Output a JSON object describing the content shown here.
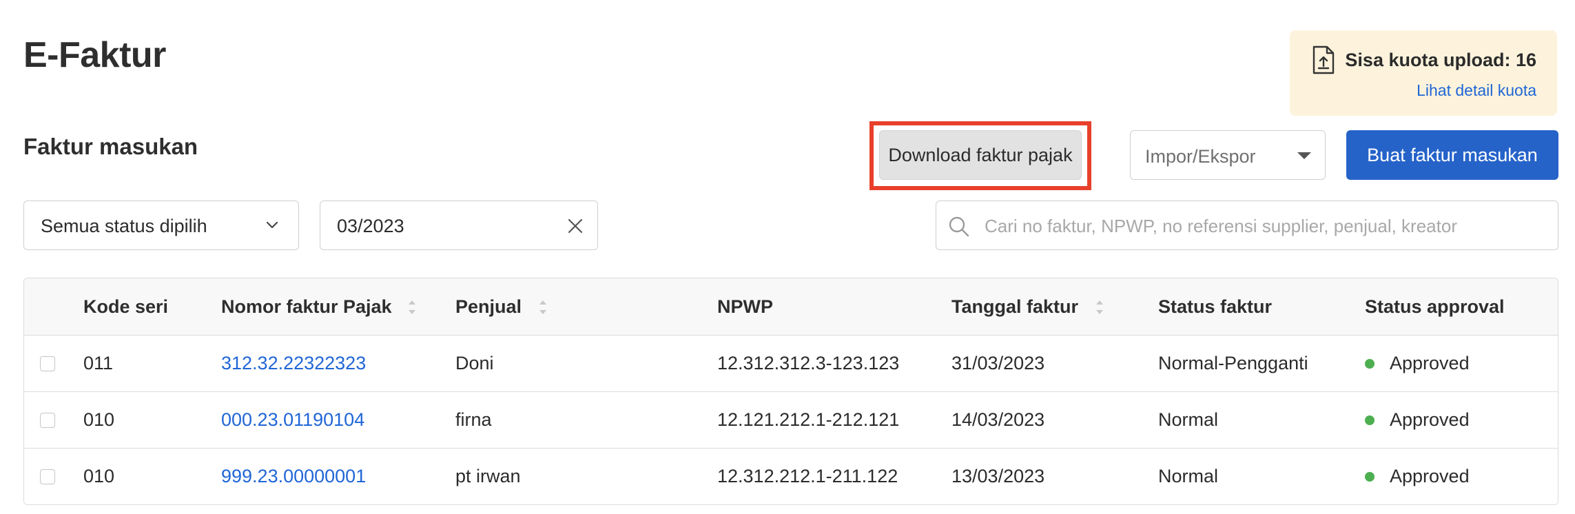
{
  "page": {
    "title": "E-Faktur"
  },
  "quota": {
    "text": "Sisa kuota upload: 16",
    "link": "Lihat detail kuota",
    "icon": "file-upload-icon"
  },
  "section": {
    "title": "Faktur masukan"
  },
  "toolbar": {
    "download_label": "Download faktur pajak",
    "import_export_label": "Impor/Ekspor",
    "create_label": "Buat faktur masukan"
  },
  "filters": {
    "status_label": "Semua status dipilih",
    "period_value": "03/2023",
    "search_placeholder": "Cari no faktur, NPWP, no referensi supplier, penjual, kreator"
  },
  "table": {
    "headers": {
      "kode_seri": "Kode seri",
      "nomor_faktur": "Nomor faktur Pajak",
      "penjual": "Penjual",
      "npwp": "NPWP",
      "tanggal": "Tanggal faktur",
      "status_faktur": "Status faktur",
      "status_approval": "Status approval"
    },
    "rows": [
      {
        "kode_seri": "011",
        "nomor_faktur": "312.32.22322323",
        "penjual": "Doni",
        "npwp": "12.312.312.3-123.123",
        "tanggal": "31/03/2023",
        "status_faktur": "Normal-Pengganti",
        "status_approval": "Approved"
      },
      {
        "kode_seri": "010",
        "nomor_faktur": "000.23.01190104",
        "penjual": "firna",
        "npwp": "12.121.212.1-212.121",
        "tanggal": "14/03/2023",
        "status_faktur": "Normal",
        "status_approval": "Approved"
      },
      {
        "kode_seri": "010",
        "nomor_faktur": "999.23.00000001",
        "penjual": "pt irwan",
        "npwp": "12.312.212.1-211.122",
        "tanggal": "13/03/2023",
        "status_faktur": "Normal",
        "status_approval": "Approved"
      }
    ]
  },
  "colors": {
    "primary": "#2563c9",
    "link": "#2066d6",
    "highlight": "#e8402b",
    "quota_bg": "#fdf3dc",
    "approved": "#4caf50"
  }
}
